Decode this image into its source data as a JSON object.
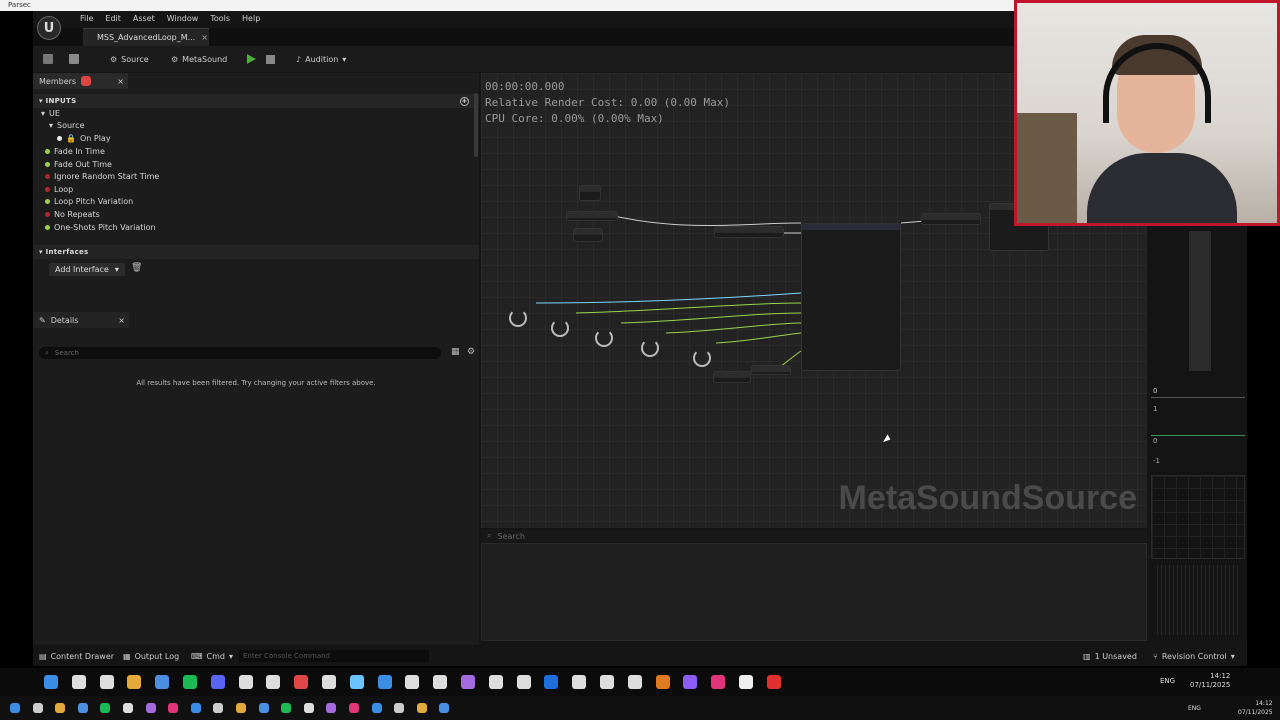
{
  "parsec": {
    "title": "Parsec"
  },
  "menu": {
    "items": [
      "File",
      "Edit",
      "Asset",
      "Window",
      "Tools",
      "Help"
    ]
  },
  "document_tab": {
    "label": "MSS_AdvancedLoop_M...",
    "close": "×"
  },
  "toolbar": {
    "source_label": "Source",
    "metasound_label": "MetaSound",
    "audition_label": "Audition"
  },
  "members_panel": {
    "tab_label": "Members",
    "inputs_header": "INPUTS",
    "category_ue": "UE",
    "category_source": "Source",
    "on_play": "On Play",
    "items": [
      {
        "label": "Fade In Time",
        "color": "#9bd44a"
      },
      {
        "label": "Fade Out Time",
        "color": "#9bd44a"
      },
      {
        "label": "Ignore Random Start Time",
        "color": "#b3262b"
      },
      {
        "label": "Loop",
        "color": "#b3262b"
      },
      {
        "label": "Loop Pitch Variation",
        "color": "#9bd44a"
      },
      {
        "label": "No Repeats",
        "color": "#b3262b"
      },
      {
        "label": "One-Shots Pitch Variation",
        "color": "#9bd44a"
      }
    ]
  },
  "interfaces": {
    "header": "Interfaces",
    "add_interface": "Add Interface"
  },
  "details": {
    "tab_label": "Details",
    "search_placeholder": "Search",
    "empty_message": "All results have been filtered. Try changing your active filters above."
  },
  "graph": {
    "time": "00:00:00.000",
    "render_cost": "Relative Render Cost: 0.00 (0.00 Max)",
    "cpu_core": "CPU Core: 0.00% (0.00% Max)",
    "watermark": "MetaSoundSource"
  },
  "bottom_panel": {
    "search_placeholder": "Search"
  },
  "statusbar": {
    "content_drawer": "Content Drawer",
    "output_log": "Output Log",
    "cmd": "Cmd",
    "console_placeholder": "Enter Console Command",
    "unsaved": "1 Unsaved",
    "revision_control": "Revision Control"
  },
  "meters": {
    "top_value": "0",
    "v1": "1",
    "v0": "0",
    "vm1": "-1"
  },
  "tray": {
    "lang": "ENG",
    "time": "14:12",
    "date": "07/11/2025"
  }
}
